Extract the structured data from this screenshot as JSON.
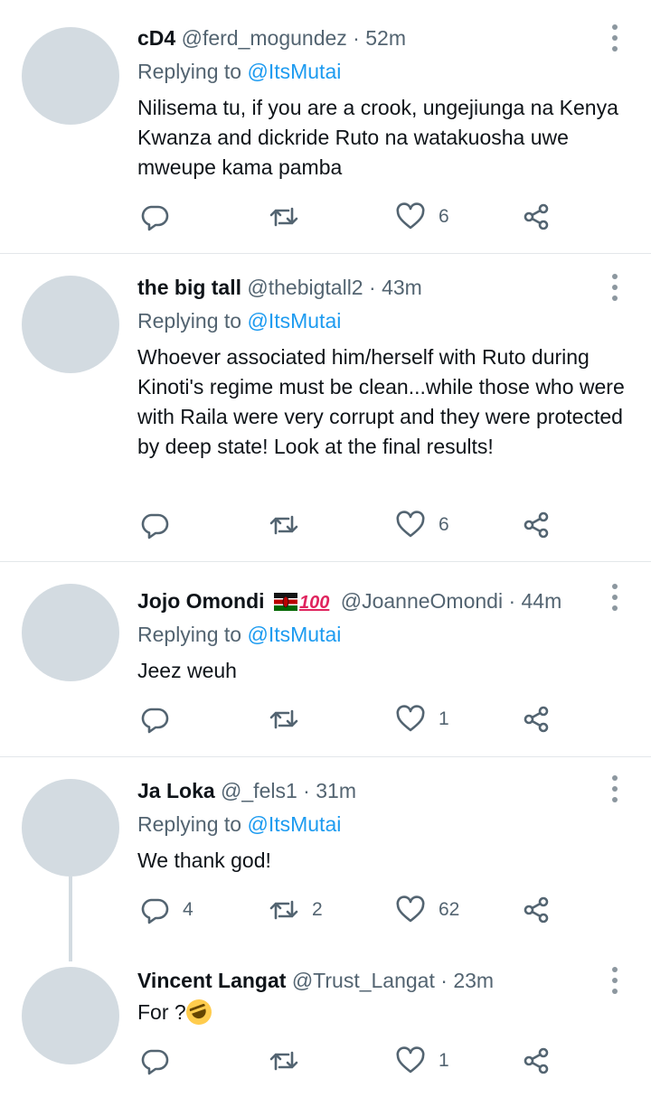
{
  "replying_prefix": "Replying to",
  "tweets": [
    {
      "name": "cD4",
      "handle": "@ferd_mogundez",
      "dot": "·",
      "time": "52m",
      "replying_to": "@ItsMutai",
      "text": "Nilisema tu, if you are a crook, ungejiunga na Kenya Kwanza and dickride Ruto na watakuosha uwe mweupe kama pamba",
      "replies": "",
      "retweets": "",
      "likes": "6"
    },
    {
      "name": "the big tall",
      "handle": "@thebigtall2",
      "dot": "·",
      "time": "43m",
      "replying_to": "@ItsMutai",
      "text": "Whoever associated him/herself with Ruto during Kinoti's regime must be clean...while those who were with Raila were very corrupt and they were protected by deep state! Look at the final results!",
      "replies": "",
      "retweets": "",
      "likes": "6"
    },
    {
      "name": "Jojo Omondi",
      "name_emoji": "100",
      "handle": "@JoanneOmondi",
      "dot": "·",
      "time": "44m",
      "replying_to": "@ItsMutai",
      "text": "Jeez weuh",
      "replies": "",
      "retweets": "",
      "likes": "1"
    },
    {
      "name": "Ja Loka",
      "handle": "@_fels1",
      "dot": "·",
      "time": "31m",
      "replying_to": "@ItsMutai",
      "text": "We thank god!",
      "replies": "4",
      "retweets": "2",
      "likes": "62"
    },
    {
      "name": "Vincent Langat",
      "handle": "@Trust_Langat",
      "dot": "·",
      "time": "23m",
      "text": "For ?",
      "replies": "",
      "retweets": "",
      "likes": "1"
    }
  ],
  "icons": {
    "reply": "reply-icon",
    "retweet": "retweet-icon",
    "like": "heart-icon",
    "share": "share-icon",
    "more": "more-icon"
  },
  "colors": {
    "link": "#1d9bf0",
    "muted": "#536471",
    "avatar": "#d3dbe1",
    "divider": "#e3e7ea"
  }
}
